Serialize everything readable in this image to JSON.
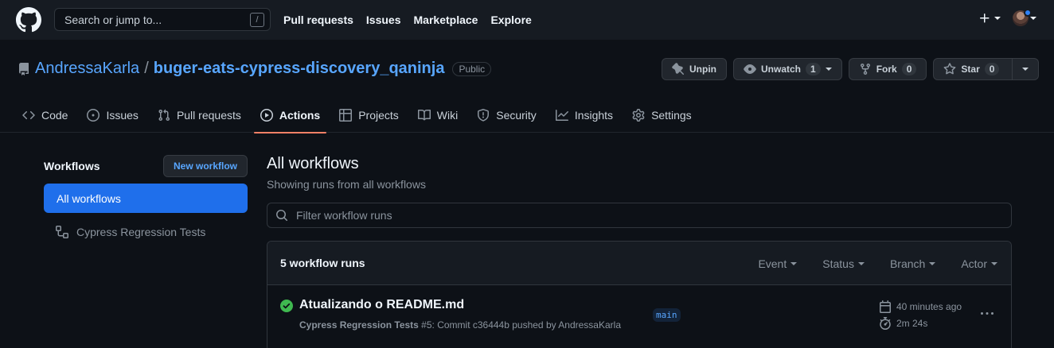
{
  "header": {
    "search_placeholder": "Search or jump to...",
    "search_shortcut": "/",
    "nav": [
      "Pull requests",
      "Issues",
      "Marketplace",
      "Explore"
    ],
    "plus_label": "+"
  },
  "repo": {
    "owner": "AndressaKarla",
    "separator": "/",
    "name": "buger-eats-cypress-discovery_qaninja",
    "visibility": "Public",
    "actions": {
      "unpin": "Unpin",
      "unwatch": "Unwatch",
      "unwatch_count": "1",
      "fork": "Fork",
      "fork_count": "0",
      "star": "Star",
      "star_count": "0"
    },
    "tabs": [
      {
        "label": "Code",
        "icon": "code-icon"
      },
      {
        "label": "Issues",
        "icon": "issue-icon"
      },
      {
        "label": "Pull requests",
        "icon": "pull-request-icon"
      },
      {
        "label": "Actions",
        "icon": "play-icon",
        "active": true
      },
      {
        "label": "Projects",
        "icon": "table-icon"
      },
      {
        "label": "Wiki",
        "icon": "book-icon"
      },
      {
        "label": "Security",
        "icon": "shield-icon"
      },
      {
        "label": "Insights",
        "icon": "graph-icon"
      },
      {
        "label": "Settings",
        "icon": "gear-icon"
      }
    ]
  },
  "sidebar": {
    "title": "Workflows",
    "new_workflow": "New workflow",
    "items": [
      {
        "label": "All workflows",
        "active": true
      },
      {
        "label": "Cypress Regression Tests",
        "icon": "workflow-icon"
      }
    ]
  },
  "main": {
    "title": "All workflows",
    "subtitle": "Showing runs from all workflows",
    "filter_placeholder": "Filter workflow runs",
    "runs_count": "5 workflow runs",
    "filters": [
      "Event",
      "Status",
      "Branch",
      "Actor"
    ],
    "runs": [
      {
        "title": "Atualizando o README.md",
        "workflow": "Cypress Regression Tests",
        "meta": " #5: Commit c36444b pushed by AndressaKarla",
        "branch": "main",
        "time_ago": "40 minutes ago",
        "duration": "2m 24s",
        "status": "success"
      }
    ]
  },
  "colors": {
    "accent": "#1f6feb",
    "link": "#58a6ff",
    "success": "#3fb950",
    "tab_underline": "#f78166"
  }
}
